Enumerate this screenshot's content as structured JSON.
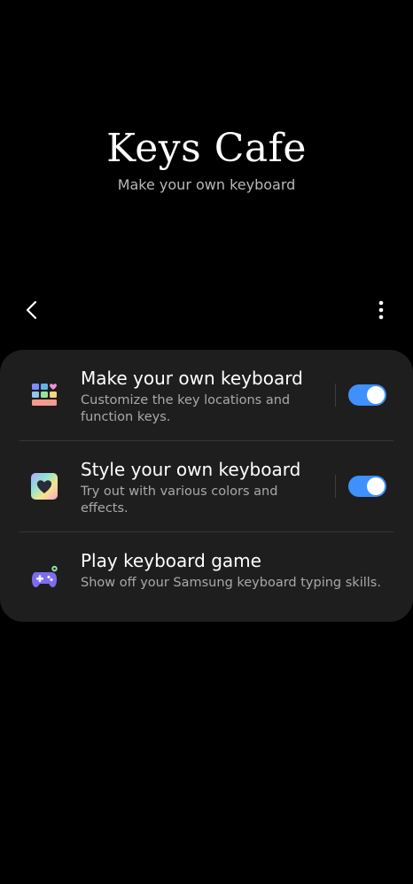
{
  "app": {
    "title": "Keys Cafe",
    "subtitle": "Make your own keyboard"
  },
  "toolbar": {
    "back_icon": "chevron-left-icon",
    "more_icon": "more-vertical-icon"
  },
  "menu": {
    "items": [
      {
        "title": "Make your own keyboard",
        "description": "Customize the key locations and function keys.",
        "icon": "keyboard-layout-icon",
        "toggle_on": true
      },
      {
        "title": "Style your own keyboard",
        "description": "Try out with various colors and effects.",
        "icon": "heart-style-icon",
        "toggle_on": true
      },
      {
        "title": "Play keyboard game",
        "description": "Show off your Samsung keyboard typing skills.",
        "icon": "gamepad-icon"
      }
    ]
  },
  "colors": {
    "background": "#000000",
    "card": "#1e1e1e",
    "toggle_accent": "#3e91ff"
  }
}
